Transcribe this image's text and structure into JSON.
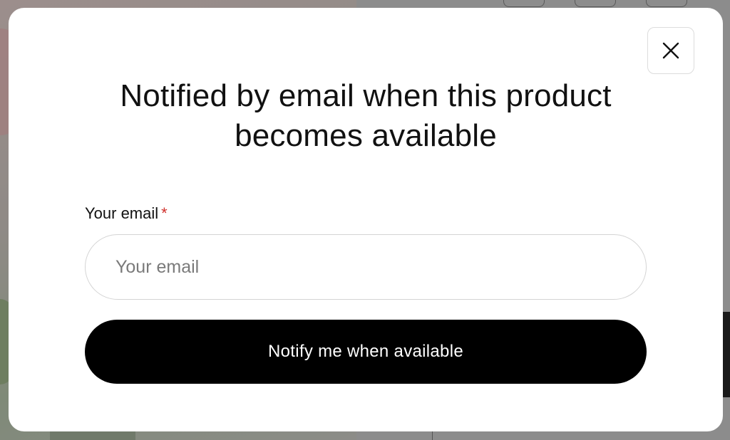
{
  "modal": {
    "title": "Notified by email when this product becomes available",
    "email_label": "Your email",
    "required_marker": "*",
    "email_placeholder": "Your email",
    "email_value": "",
    "submit_label": "Notify me when available",
    "close_icon": "close-icon"
  },
  "colors": {
    "button_bg": "#000000",
    "button_text": "#ffffff",
    "required": "#d0302b",
    "input_border": "#d4d4d4"
  }
}
